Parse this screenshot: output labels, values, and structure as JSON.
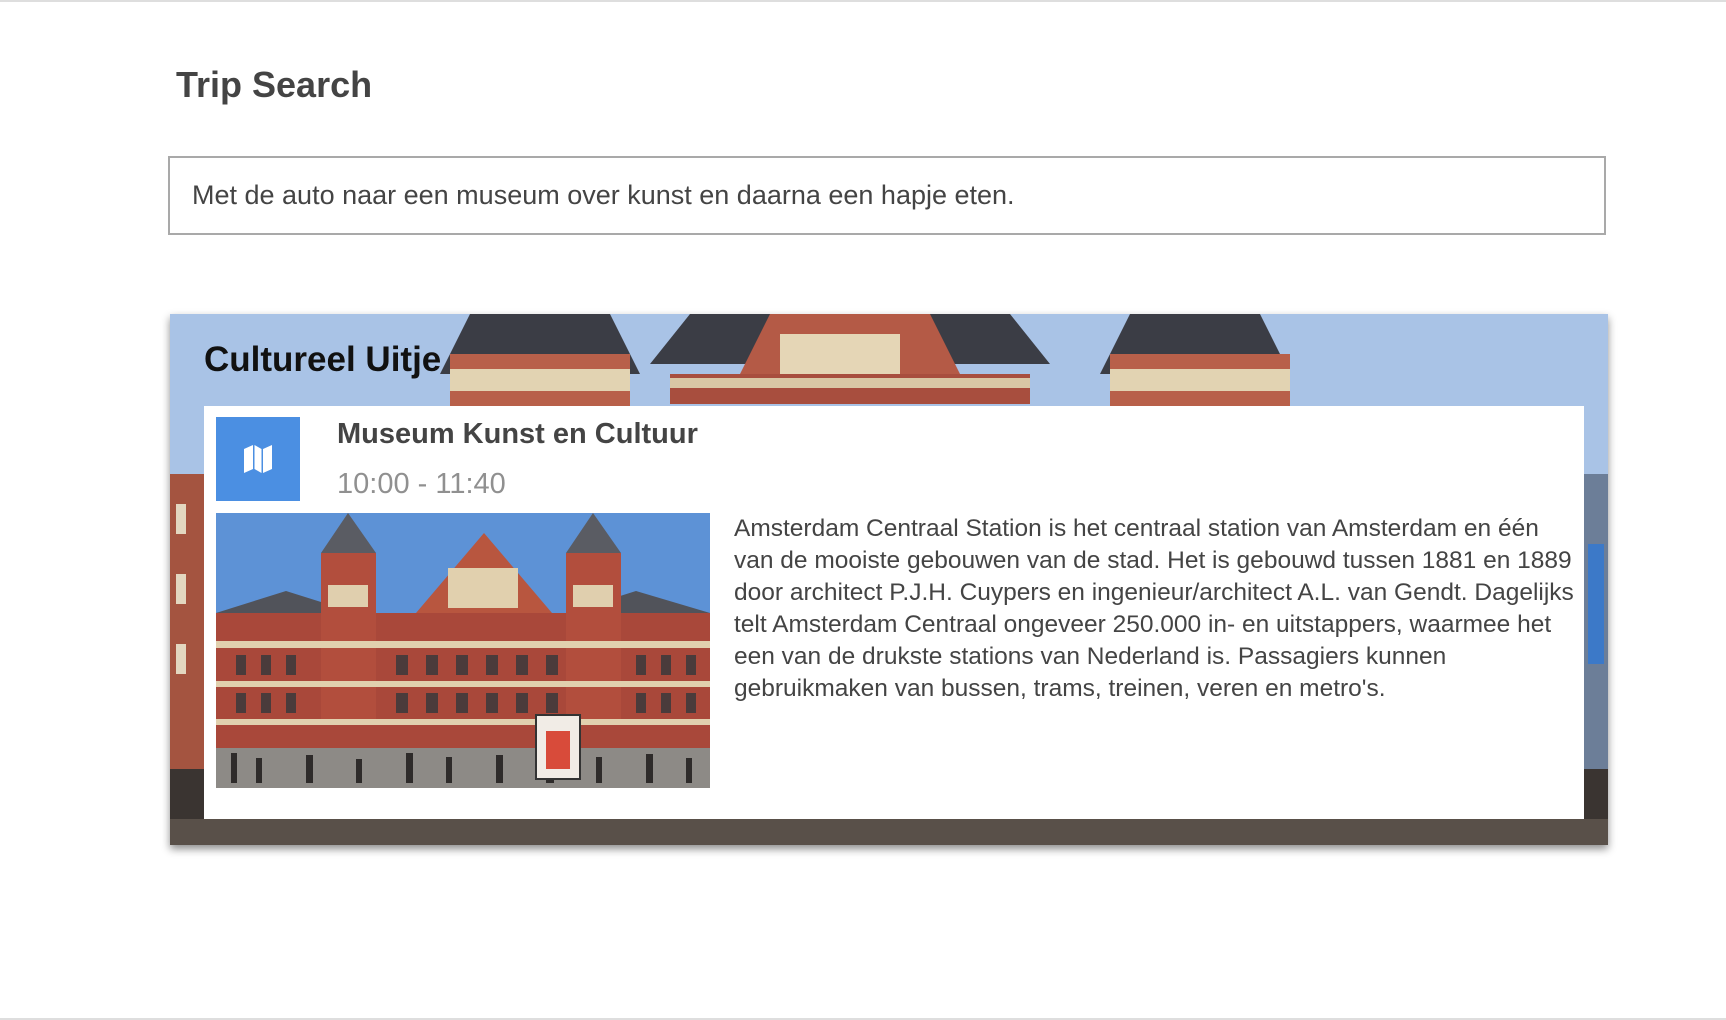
{
  "page": {
    "title": "Trip Search"
  },
  "search": {
    "value": "Met de auto naar een museum over kunst en daarna een hapje eten."
  },
  "trip": {
    "heading": "Cultureel Uitje",
    "activity": {
      "icon": "map-icon",
      "icon_color": "#4b8fe2",
      "title": "Museum Kunst en Cultuur",
      "time": "10:00 - 11:40",
      "description": "Amsterdam Centraal Station is het centraal station van Amsterdam en één van de mooiste gebouwen van de stad. Het is gebouwd tussen 1881 en 1889 door architect P.J.H. Cuypers en ingenieur/architect A.L. van Gendt. Dagelijks telt Amsterdam Centraal ongeveer 250.000 in- en uitstappers, waarmee het een van de drukste stations van Nederland is. Passagiers kunnen gebruikmaken van bussen, trams, treinen, veren en metro's."
    }
  }
}
